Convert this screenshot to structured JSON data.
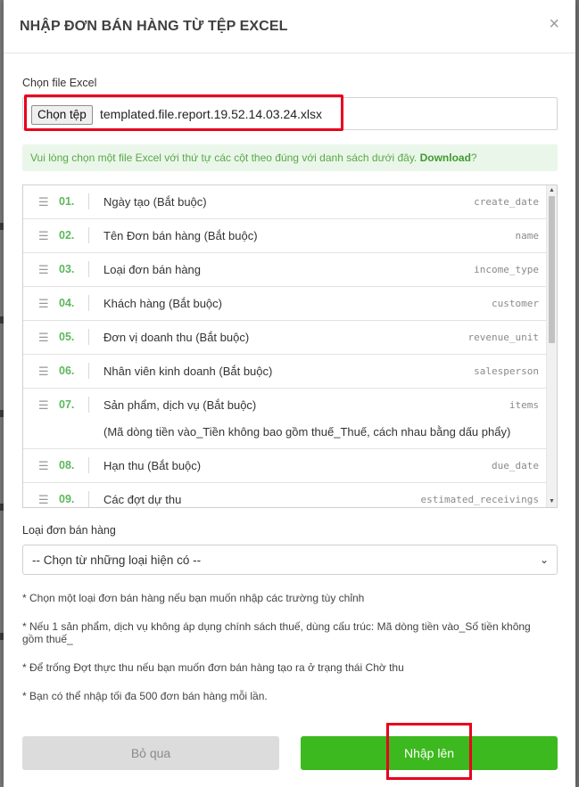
{
  "modal": {
    "title": "NHẬP ĐƠN BÁN HÀNG TỪ TỆP EXCEL",
    "close_icon": "close-icon"
  },
  "file": {
    "label": "Chọn file Excel",
    "button": "Chọn tệp",
    "filename": "templated.file.report.19.52.14.03.24.xlsx"
  },
  "alert": {
    "text": "Vui lòng chọn một file Excel với thứ tự các cột theo đúng với danh sách dưới đây. ",
    "link": "Download",
    "suffix": "?"
  },
  "columns": [
    {
      "num": "01.",
      "name": "Ngày tạo (Bắt buộc)",
      "key": "create_date"
    },
    {
      "num": "02.",
      "name": "Tên Đơn bán hàng (Bắt buộc)",
      "key": "name"
    },
    {
      "num": "03.",
      "name": "Loại đơn bán hàng",
      "key": "income_type"
    },
    {
      "num": "04.",
      "name": "Khách hàng (Bắt buộc)",
      "key": "customer"
    },
    {
      "num": "05.",
      "name": "Đơn vị doanh thu (Bắt buộc)",
      "key": "revenue_unit"
    },
    {
      "num": "06.",
      "name": "Nhân viên kinh doanh (Bắt buộc)",
      "key": "salesperson"
    },
    {
      "num": "07.",
      "name": "Sản phẩm, dịch vụ (Bắt buộc)",
      "key": "items",
      "note": "(Mã dòng tiền vào_Tiền không bao gồm thuế_Thuế, cách nhau bằng dấu phẩy)"
    },
    {
      "num": "08.",
      "name": "Hạn thu (Bắt buộc)",
      "key": "due_date"
    },
    {
      "num": "09.",
      "name": "Các đợt dự thu",
      "key": "estimated_receivings"
    }
  ],
  "income_type": {
    "label": "Loại đơn bán hàng",
    "selected": "-- Chọn từ những loại hiện có --"
  },
  "notes": [
    "* Chọn một loại đơn bán hàng nếu bạn muốn nhập các trường tùy chỉnh",
    "* Nếu 1 sản phẩm, dịch vụ không áp dụng chính sách thuế, dùng cấu trúc: Mã dòng tiền vào_Số tiền không gồm thuế_",
    "* Để trống Đợt thực thu nếu bạn muốn đơn bán hàng tạo ra ở trạng thái Chờ thu",
    "* Bạn có thể nhập tối đa 500 đơn bán hàng mỗi lần."
  ],
  "buttons": {
    "cancel": "Bỏ qua",
    "submit": "Nhập lên"
  },
  "colors": {
    "accent_green": "#3cb91e",
    "highlight_red": "#e8001c"
  }
}
